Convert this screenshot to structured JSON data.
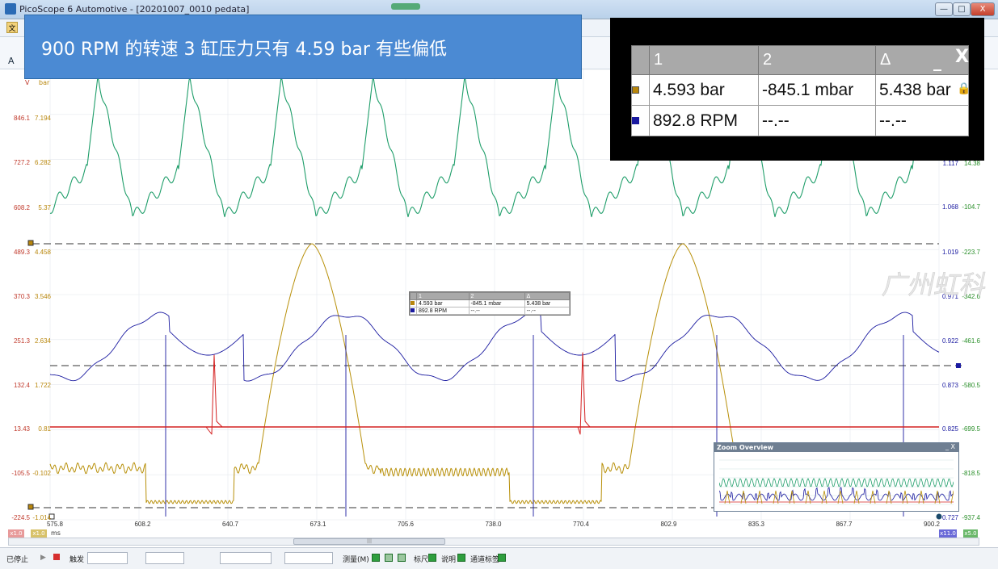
{
  "window": {
    "title": "PicoScope 6 Automotive - [20201007_0010 pedata]",
    "min_label": "—",
    "max_label": "□",
    "close_label": "X"
  },
  "banner": {
    "text": "900 RPM 的转速 3 缸压力只有 4.59 bar  有些偏低"
  },
  "units": {
    "left_a": "V",
    "left_b": "bar",
    "x": "ms"
  },
  "axes": {
    "left_a": [
      "846.1",
      "727.2",
      "608.2",
      "489.3",
      "370.3",
      "251.3",
      "132.4",
      "13.43",
      "-105.5",
      "-224.5"
    ],
    "left_b": [
      "7.194",
      "6.282",
      "5.37",
      "4.458",
      "3.546",
      "2.634",
      "1.722",
      "0.81",
      "-0.102",
      "-1.014"
    ],
    "right_a": [
      "1.117",
      "1.068",
      "1.019",
      "0.971",
      "0.922",
      "0.873",
      "0.825",
      "",
      "0.727"
    ],
    "right_b": [
      "14.38",
      "-104.7",
      "-223.7",
      "-342.6",
      "-461.6",
      "-580.5",
      "-699.5",
      "-818.5",
      "-937.4"
    ],
    "x_ticks": [
      "575.8",
      "608.2",
      "640.7",
      "673.1",
      "705.6",
      "738.0",
      "770.4",
      "802.9",
      "835.3",
      "867.7",
      "900.2"
    ]
  },
  "chips": {
    "left1": "x1.0",
    "left2": "x1.0",
    "right1": "x11.0",
    "right2": "x5.0"
  },
  "readout": {
    "headers": [
      "1",
      "2",
      "Δ"
    ],
    "rows": [
      {
        "color": "#b8860b",
        "c1": "4.593 bar",
        "c2": "-845.1 mbar",
        "c3": "5.438 bar"
      },
      {
        "color": "#1a1aa0",
        "c1": "892.8 RPM",
        "c2": "--.--",
        "c3": "--.--"
      }
    ],
    "close": "X",
    "minimize": "_"
  },
  "zoom_overview": {
    "title": "Zoom Overview",
    "controls": "_ X"
  },
  "status": {
    "stopped": "已停止",
    "trigger": "触发",
    "measure": "测量(M)",
    "ruler": "标尺",
    "notes": "说明",
    "channel_labels": "通道标签"
  },
  "watermark": "广州虹科",
  "colors": {
    "green_trace": "#1f9e6a",
    "gold_trace": "#b8900a",
    "blue_trace": "#1a1aa0",
    "red_trace": "#d42020",
    "banner": "#4b8ad3"
  }
}
